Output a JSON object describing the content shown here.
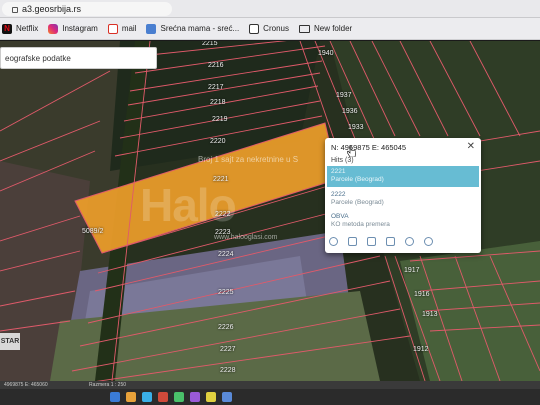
{
  "browser": {
    "url": "a3.geosrbija.rs"
  },
  "bookmarks": [
    {
      "label": "Netflix",
      "icon": "netflix-icon"
    },
    {
      "label": "Instagram",
      "icon": "instagram-icon"
    },
    {
      "label": "mail",
      "icon": "gmail-icon"
    },
    {
      "label": "Srećna mama - sreć...",
      "icon": "document-icon"
    },
    {
      "label": "Cronus",
      "icon": "cronus-icon"
    },
    {
      "label": "New folder",
      "icon": "folder-icon"
    }
  ],
  "search_panel": {
    "text": "eografske podatke"
  },
  "parcels": {
    "p2215": "2215",
    "p2216": "2216",
    "p2217": "2217",
    "p2218": "2218",
    "p2219": "2219",
    "p2220": "2220",
    "p2221": "2221",
    "p2222": "2222",
    "p2223": "2223",
    "p2224": "2224",
    "p2225": "2225",
    "p2226": "2226",
    "p2227": "2227",
    "p2228": "2228",
    "p1940": "1940",
    "p1937": "1937",
    "p1936": "1936",
    "p1933": "1933",
    "p1917": "1917",
    "p1916": "1916",
    "p1913": "1913",
    "p1912": "1912",
    "p5089": "5089/2"
  },
  "watermark": {
    "text": "Broj 1 sajt za nekretnine u S",
    "logo": "Halo",
    "url": "www.halooglasi.com"
  },
  "popup": {
    "coords": "N: 4969875 E: 465045",
    "hits": "Hits (3)",
    "results": [
      {
        "title": "2221",
        "subtitle": "Parcele (Beograd)"
      },
      {
        "title": "2222",
        "subtitle": "Parcele (Beograd)"
      },
      {
        "title": "OBVA",
        "subtitle": "KO metoda premera"
      }
    ]
  },
  "left_button": {
    "label": "STAR"
  },
  "statusbar": {
    "coords": "4969875 E: 465060",
    "scale": "Razmera 1 : 250"
  },
  "colors": {
    "selected_parcel": "#f2a12a",
    "parcel_border": "#e05a6a",
    "popup_highlight": "#67bcd3"
  }
}
